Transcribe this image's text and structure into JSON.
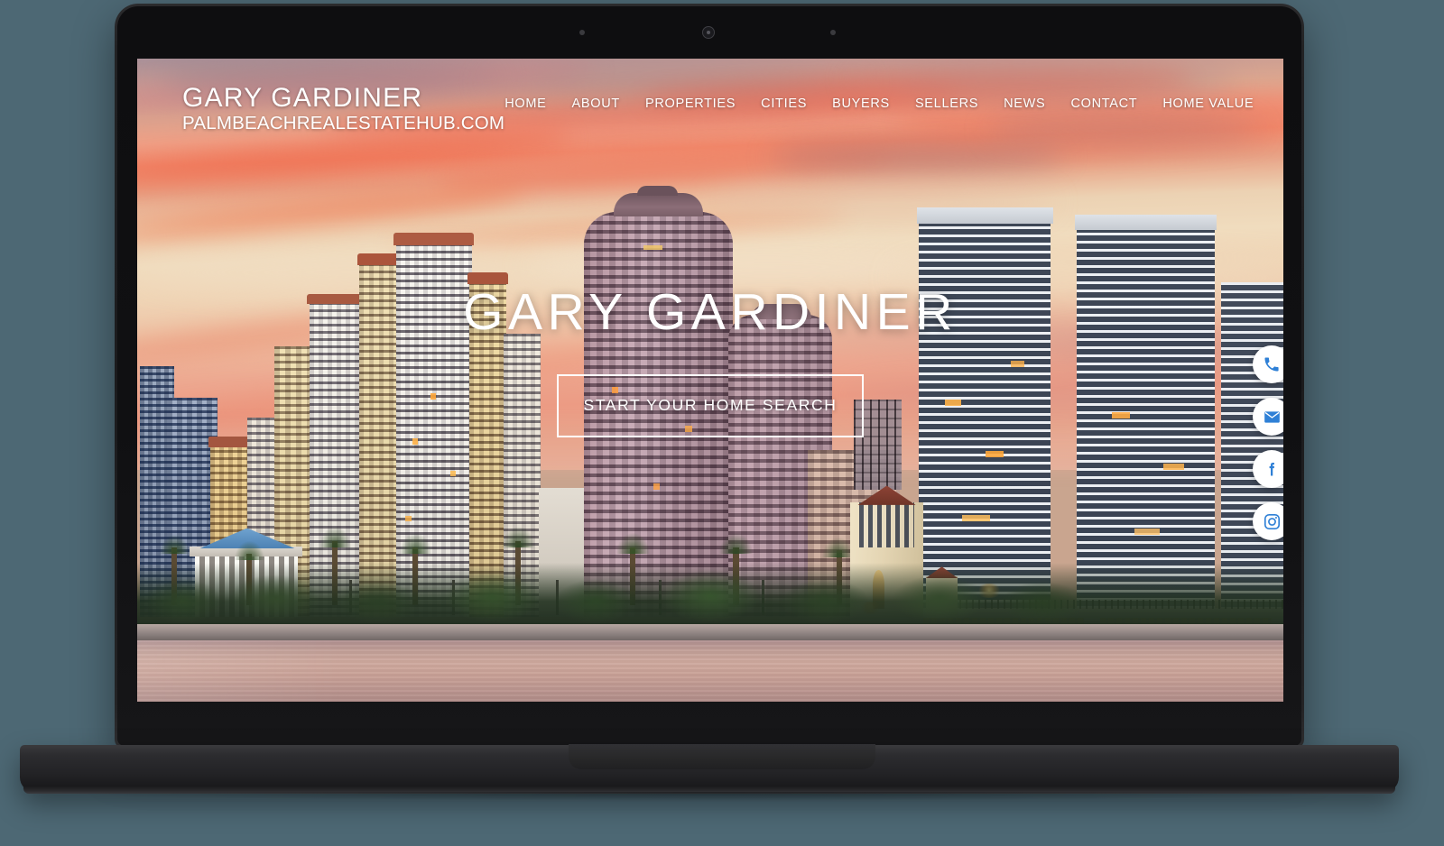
{
  "background_color": "#4d6874",
  "device": {
    "type": "laptop-mockup",
    "bezel_color": "#141416",
    "body_color": "#2a2a2d"
  },
  "site": {
    "brand": {
      "name": "GARY GARDINER",
      "domain": "PALMBEACHREALESTATEHUB.COM"
    },
    "nav": {
      "items": [
        {
          "label": "HOME"
        },
        {
          "label": "ABOUT"
        },
        {
          "label": "PROPERTIES"
        },
        {
          "label": "CITIES"
        },
        {
          "label": "BUYERS"
        },
        {
          "label": "SELLERS"
        },
        {
          "label": "NEWS"
        },
        {
          "label": "CONTACT"
        },
        {
          "label": "HOME VALUE"
        }
      ]
    },
    "hero": {
      "title": "GARY GARDINER",
      "cta_label": "START YOUR HOME SEARCH",
      "background_description": "West Palm Beach waterfront skyline at sunset with drawbridge",
      "text_color": "#ffffff"
    },
    "social_rail": {
      "icon_color": "#2f80d6",
      "button_color": "#ffffff",
      "items": [
        {
          "name": "phone-icon",
          "label": "Call"
        },
        {
          "name": "email-icon",
          "label": "Email"
        },
        {
          "name": "facebook-icon",
          "label": "Facebook"
        },
        {
          "name": "instagram-icon",
          "label": "Instagram"
        }
      ]
    }
  }
}
